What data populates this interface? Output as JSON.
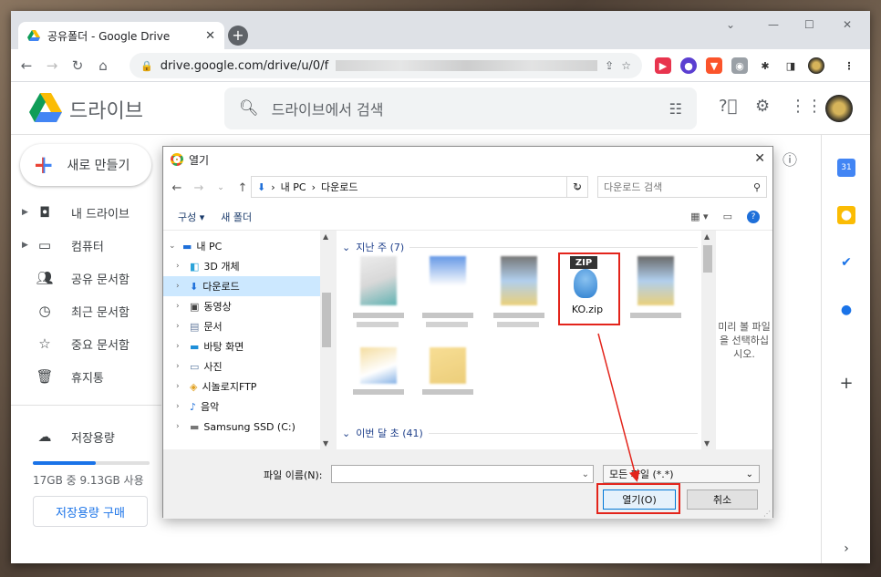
{
  "browser": {
    "tab_title": "공유폴더 - Google Drive",
    "tab_close": "✕",
    "new_tab": "+",
    "url": "drive.google.com/drive/u/0/f"
  },
  "drive": {
    "name": "드라이브",
    "search_placeholder": "드라이브에서 검색",
    "new_button": "새로 만들기",
    "sidebar": [
      {
        "label": "내 드라이브",
        "icon": "drive-icon",
        "arrow": true
      },
      {
        "label": "컴퓨터",
        "icon": "computer-icon",
        "arrow": true
      },
      {
        "label": "공유 문서함",
        "icon": "people-icon",
        "arrow": false
      },
      {
        "label": "최근 문서함",
        "icon": "clock-icon",
        "arrow": false
      },
      {
        "label": "중요 문서함",
        "icon": "star-icon",
        "arrow": false
      },
      {
        "label": "휴지통",
        "icon": "trash-icon",
        "arrow": false
      }
    ],
    "storage_label": "저장용량",
    "storage_text": "17GB 중 9.13GB 사용",
    "storage_fraction": 0.54,
    "buy_storage": "저장용량 구매"
  },
  "dialog": {
    "title": "열기",
    "close": "✕",
    "breadcrumb": [
      "내 PC",
      "다운로드"
    ],
    "search_placeholder": "다운로드 검색",
    "toolbar": {
      "organize": "구성 ▾",
      "new_folder": "새 폴더"
    },
    "tree": [
      {
        "label": "내 PC",
        "expanded": true,
        "level": 0
      },
      {
        "label": "3D 개체",
        "level": 1
      },
      {
        "label": "다운로드",
        "level": 1,
        "selected": true
      },
      {
        "label": "동영상",
        "level": 1
      },
      {
        "label": "문서",
        "level": 1
      },
      {
        "label": "바탕 화면",
        "level": 1
      },
      {
        "label": "사진",
        "level": 1
      },
      {
        "label": "시놀로지FTP",
        "level": 1
      },
      {
        "label": "음악",
        "level": 1
      },
      {
        "label": "Samsung SSD (C:)",
        "level": 1
      }
    ],
    "group_last_week": "지난 주 (7)",
    "group_this_month": "이번 달 초 (41)",
    "selected_file": {
      "name": "KO.zip",
      "badge": "ZIP"
    },
    "preview_text": "미리 볼 파일을 선택하십시오.",
    "filename_label": "파일 이름(N):",
    "filetype": "모든 파일 (*.*)",
    "open_button": "열기(O)",
    "cancel_button": "취소"
  },
  "colors": {
    "highlight": "#e3241b",
    "selection": "#cce8ff",
    "accent": "#1a73e8"
  }
}
